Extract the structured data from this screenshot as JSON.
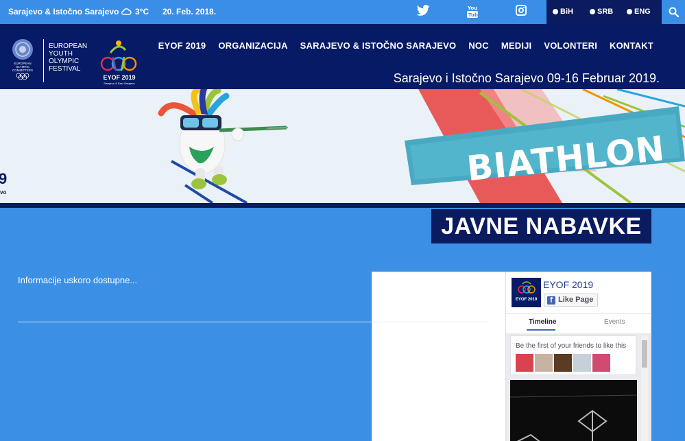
{
  "topbar": {
    "location": "Sarajevo & Istočno Sarajevo",
    "temperature": "3°C",
    "date": "20. Feb. 2018.",
    "languages": [
      "BiH",
      "SRB",
      "ENG"
    ]
  },
  "header": {
    "eoc_text": [
      "EUROPEAN",
      "YOUTH",
      "OLYMPIC",
      "FESTIVAL"
    ],
    "eoc_logo_text": "EUROPEAN OLYMPIC COMMITTEES",
    "eyof_logo_text": "EYOF 2019",
    "eyof_logo_sub": "Sarajevo & East Sarajevo",
    "nav": [
      "EYOF 2019",
      "ORGANIZACIJA",
      "SARAJEVO & ISTOČNO SARAJEVO",
      "NOC",
      "MEDIJI",
      "VOLONTERI",
      "KONTAKT"
    ],
    "tagline": "Sarajevo i Istočno Sarajevo 09-16 Februar 2019."
  },
  "banner": {
    "sport": "BIATHLON",
    "left_num": "9",
    "left_sub": "vo"
  },
  "page": {
    "title": "JAVNE NABAVKE",
    "content": "Informacije uskoro dostupne..."
  },
  "fb_widget": {
    "page_name": "EYOF 2019",
    "like_label": "Like Page",
    "tabs": [
      "Timeline",
      "Events"
    ],
    "friends_text": "Be the first of your friends to like this"
  },
  "colors": {
    "topbar": "#3a8ee6",
    "navy": "#071a66",
    "body": "#3b8fe5"
  }
}
